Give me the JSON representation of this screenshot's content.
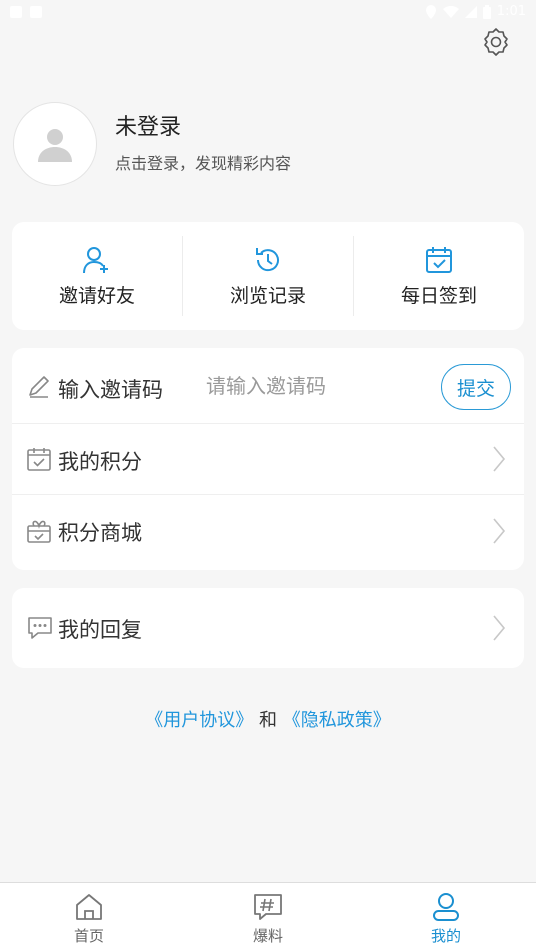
{
  "status_bar": {
    "time": "1:01"
  },
  "profile": {
    "name": "未登录",
    "subtitle": "点击登录，发现精彩内容"
  },
  "quick_actions": [
    {
      "label": "邀请好友",
      "icon": "add-user-icon"
    },
    {
      "label": "浏览记录",
      "icon": "history-icon"
    },
    {
      "label": "每日签到",
      "icon": "calendar-check-icon"
    }
  ],
  "invite": {
    "label": "输入邀请码",
    "placeholder": "请输入邀请码",
    "submit_label": "提交"
  },
  "list_items": [
    {
      "label": "我的积分",
      "icon": "calendar-check-icon"
    },
    {
      "label": "积分商城",
      "icon": "gift-box-icon"
    }
  ],
  "reply": {
    "label": "我的回复",
    "icon": "chat-icon"
  },
  "agreement": {
    "user_agreement": "《用户协议》",
    "connector": "和",
    "privacy_policy": "《隐私政策》"
  },
  "tabs": [
    {
      "label": "首页",
      "icon": "home-icon",
      "active": false
    },
    {
      "label": "爆料",
      "icon": "hashtag-icon",
      "active": false
    },
    {
      "label": "我的",
      "icon": "user-icon",
      "active": true
    }
  ],
  "colors": {
    "accent": "#1a8fd0",
    "background": "#f6f6f6"
  }
}
